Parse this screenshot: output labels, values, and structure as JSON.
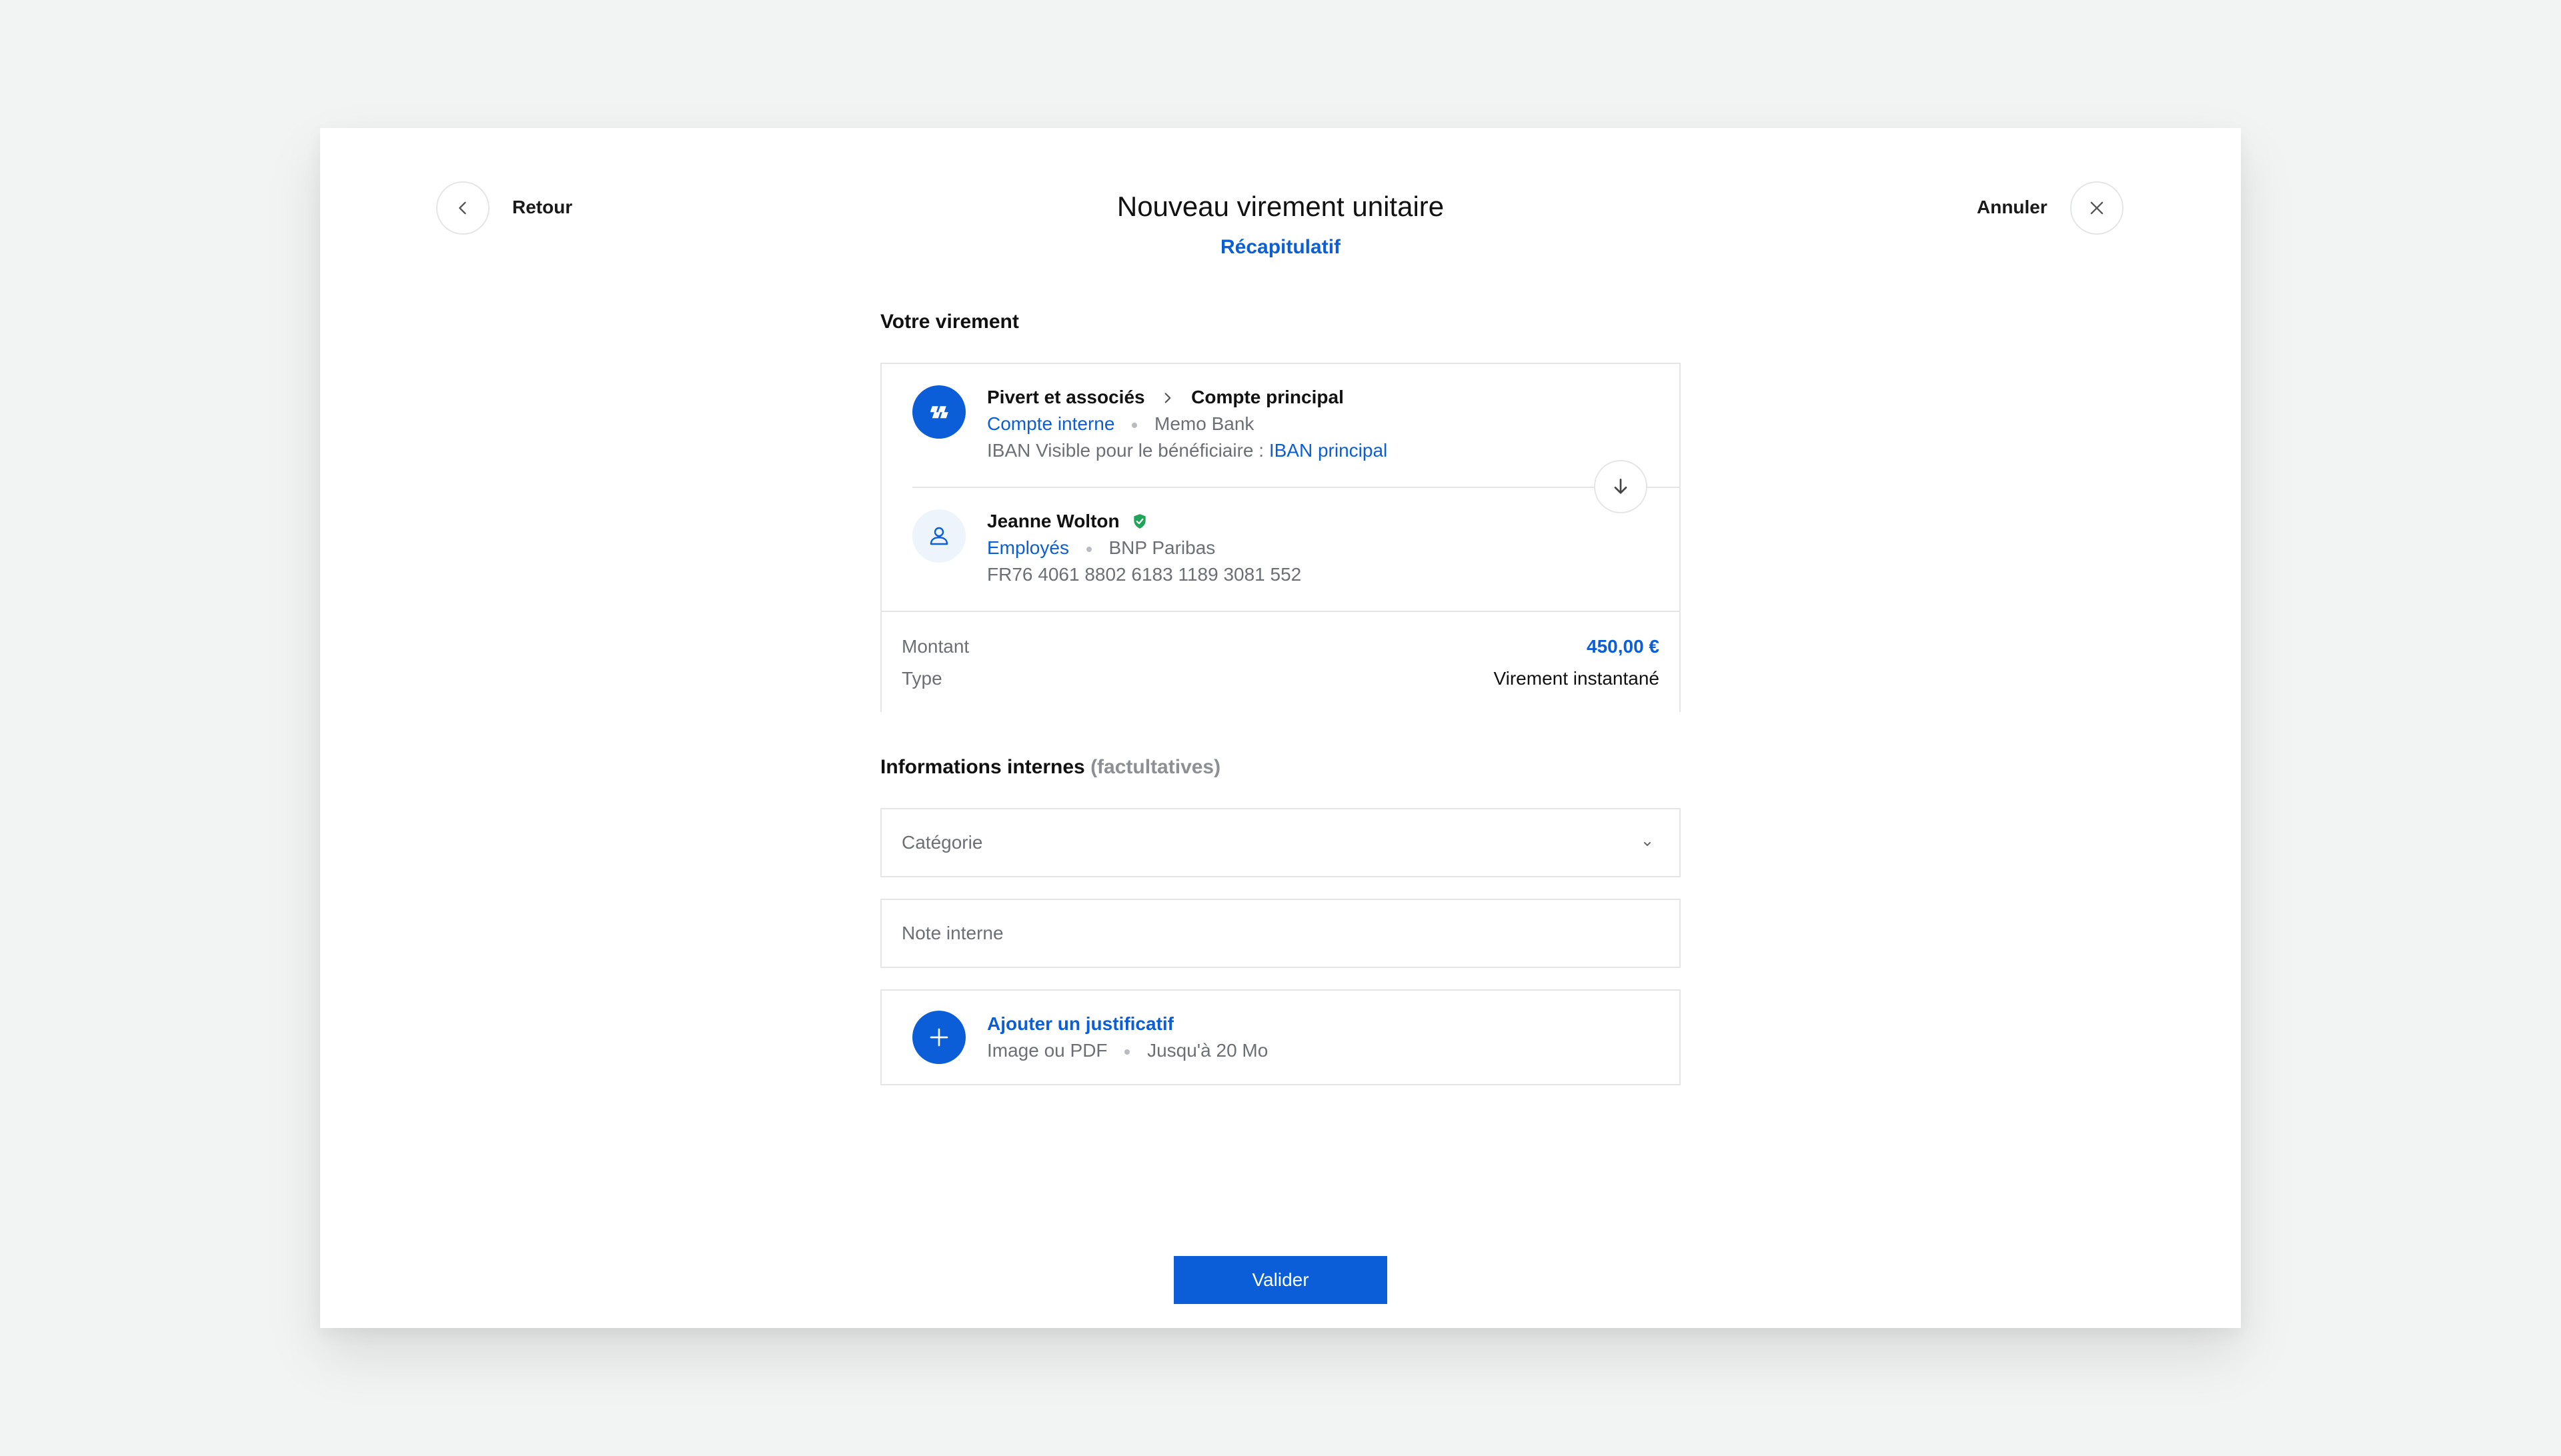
{
  "header": {
    "back_label": "Retour",
    "title": "Nouveau virement unitaire",
    "step": "Récapitulatif",
    "cancel_label": "Annuler"
  },
  "transfer": {
    "section_title": "Votre virement",
    "sender": {
      "name": "Pivert et associés",
      "account": "Compte principal",
      "type": "Compte interne",
      "bank": "Memo Bank",
      "iban_label": "IBAN Visible pour le bénéficiaire :",
      "iban_value": "IBAN principal",
      "icon": "company-logo-icon"
    },
    "recipient": {
      "name": "Jeanne Wolton",
      "verified_icon": "verified-shield-icon",
      "category": "Employés",
      "bank": "BNP Paribas",
      "iban": "FR76 4061 8802 6183 1189 3081 552",
      "icon": "user-icon"
    },
    "summary": {
      "amount_label": "Montant",
      "amount_value": "450,00 €",
      "type_label": "Type",
      "type_value": "Virement instantané"
    }
  },
  "internal": {
    "section_title": "Informations internes",
    "section_optional": "(factultatives)",
    "category_placeholder": "Catégorie",
    "note_placeholder": "Note interne",
    "attachment": {
      "title": "Ajouter un justificatif",
      "formats": "Image ou PDF",
      "limit": "Jusqu'à 20 Mo"
    }
  },
  "actions": {
    "validate_label": "Valider"
  },
  "colors": {
    "accent": "#0b5ed7",
    "verified": "#1fa45a",
    "background": "#f2f3f3"
  }
}
